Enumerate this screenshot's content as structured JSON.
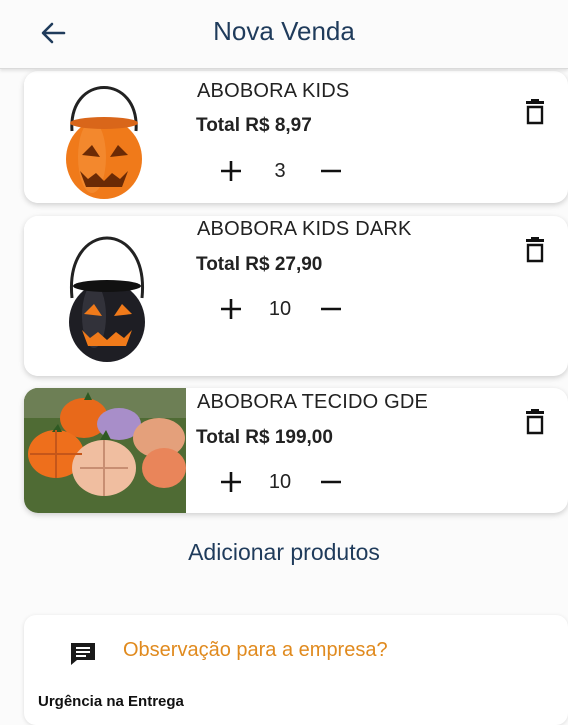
{
  "header": {
    "title": "Nova Venda",
    "back_icon": "arrow-left-icon"
  },
  "products": [
    {
      "name": "ABOBORA KIDS",
      "total": "Total R$ 8,97",
      "quantity": "3",
      "image": "orange-pumpkin-bucket"
    },
    {
      "name": "ABOBORA KIDS DARK",
      "total": "Total R$ 27,90",
      "quantity": "10",
      "image": "black-pumpkin-bucket"
    },
    {
      "name": "ABOBORA TECIDO GDE",
      "total": "Total R$ 199,00",
      "quantity": "10",
      "image": "fabric-pumpkins-on-grass"
    }
  ],
  "icons": {
    "increment": "plus-icon",
    "decrement": "minus-icon",
    "delete": "trash-icon",
    "notes": "message-icon"
  },
  "add_products_label": "Adicionar produtos",
  "notes": {
    "title": "Observação para a empresa?",
    "subtitle": "Urgência na Entrega"
  },
  "colors": {
    "primary": "#1f3b5b",
    "accent": "#e08a1e"
  }
}
